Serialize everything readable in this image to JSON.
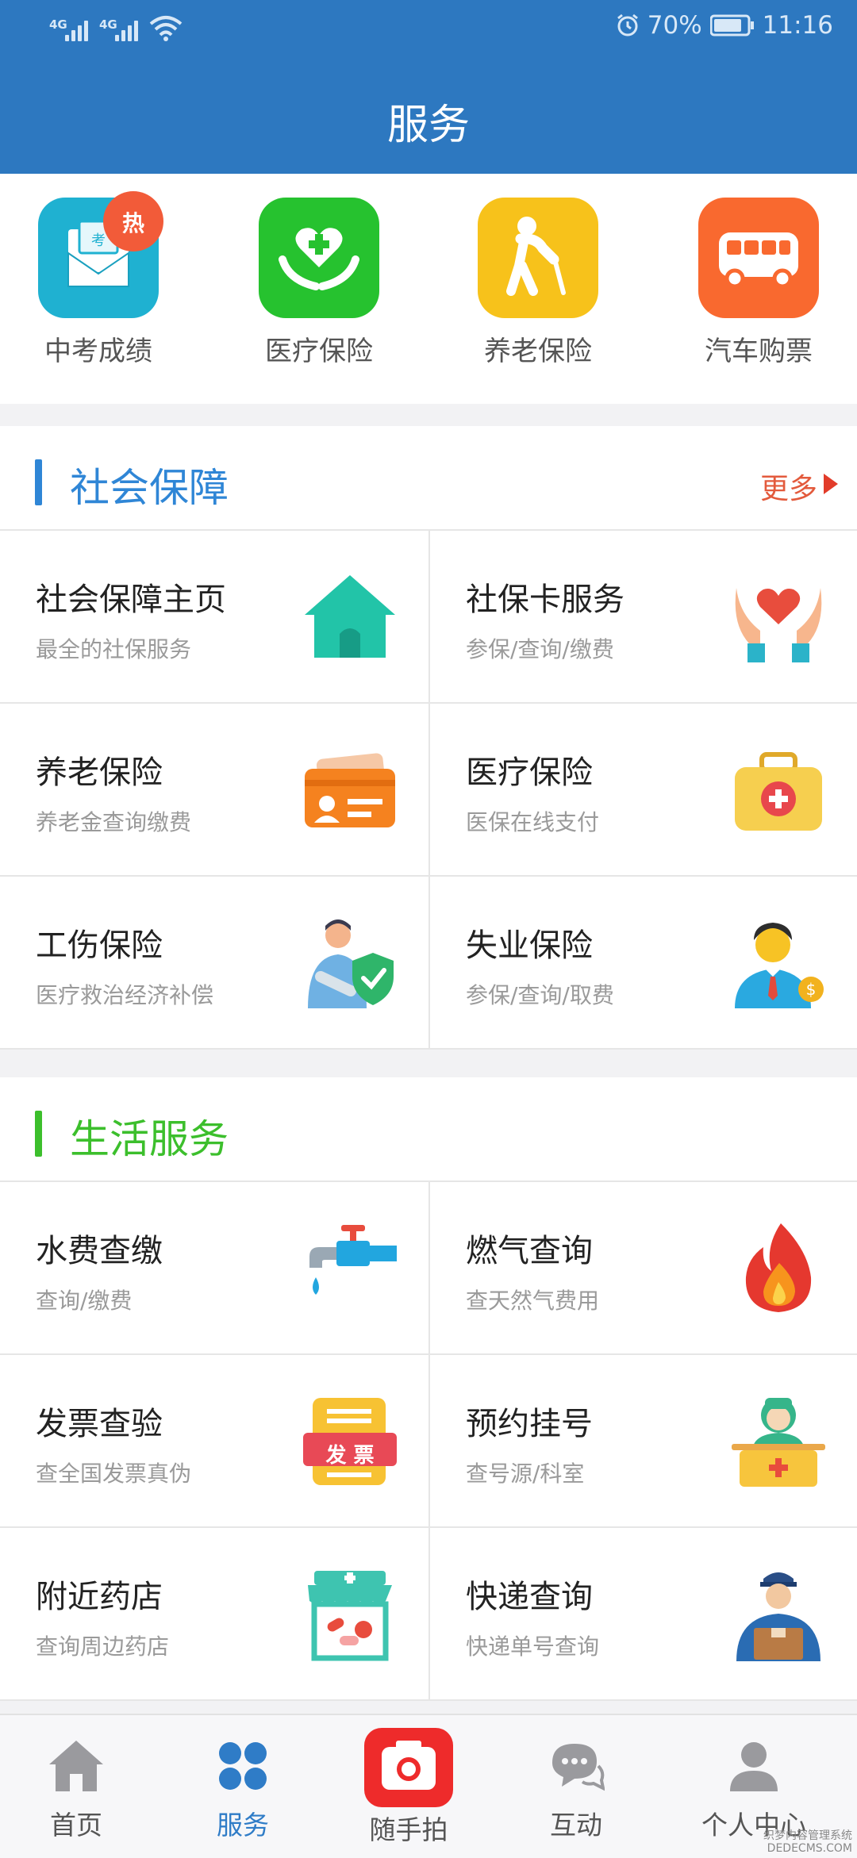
{
  "status_bar": {
    "net1": "4G",
    "net2": "4G",
    "battery": "70%",
    "time": "11:16"
  },
  "header": {
    "title": "服务"
  },
  "quick_services": [
    {
      "label": "中考成绩",
      "badge": "热",
      "icon": "exam-mail-icon",
      "color": "#1fb1d1"
    },
    {
      "label": "医疗保险",
      "icon": "heart-hands-icon",
      "color": "#26c22f"
    },
    {
      "label": "养老保险",
      "icon": "elderly-person-icon",
      "color": "#f7c21b"
    },
    {
      "label": "汽车购票",
      "icon": "bus-icon",
      "color": "#f9692f"
    }
  ],
  "social_security": {
    "title": "社会保障",
    "title_color": "#2f86d6",
    "more_label": "更多",
    "items": [
      {
        "name": "社会保障主页",
        "desc": "最全的社保服务",
        "icon": "house-icon"
      },
      {
        "name": "社保卡服务",
        "desc": "参保/查询/缴费",
        "icon": "heart-in-hands-icon"
      },
      {
        "name": "养老保险",
        "desc": "养老金查询缴费",
        "icon": "id-card-icon"
      },
      {
        "name": "医疗保险",
        "desc": "医保在线支付",
        "icon": "medical-kit-icon"
      },
      {
        "name": "工伤保险",
        "desc": "医疗救治经济补偿",
        "icon": "injured-worker-icon"
      },
      {
        "name": "失业保险",
        "desc": "参保/查询/取费",
        "icon": "businessman-coin-icon"
      }
    ]
  },
  "life_services": {
    "title": "生活服务",
    "title_color": "#3cbf2c",
    "items": [
      {
        "name": "水费查缴",
        "desc": "查询/缴费",
        "icon": "water-tap-icon"
      },
      {
        "name": "燃气查询",
        "desc": "查天然气费用",
        "icon": "flame-icon"
      },
      {
        "name": "发票查验",
        "desc": "查全国发票真伪",
        "icon": "invoice-icon",
        "icon_text": "发 票"
      },
      {
        "name": "预约挂号",
        "desc": "查号源/科室",
        "icon": "doctor-icon"
      },
      {
        "name": "附近药店",
        "desc": "查询周边药店",
        "icon": "pharmacy-icon"
      },
      {
        "name": "快递查询",
        "desc": "快递单号查询",
        "icon": "courier-icon"
      }
    ]
  },
  "bottom_nav": [
    {
      "label": "首页",
      "icon": "home-icon",
      "active": false
    },
    {
      "label": "服务",
      "icon": "four-petal-icon",
      "active": true
    },
    {
      "label": "随手拍",
      "icon": "camera-icon",
      "active": false
    },
    {
      "label": "互动",
      "icon": "chat-bubbles-icon",
      "active": false
    },
    {
      "label": "个人中心",
      "icon": "person-icon",
      "active": false
    }
  ],
  "watermark": {
    "line1": "织梦内容管理系统",
    "line2": "DEDECMS.COM"
  }
}
